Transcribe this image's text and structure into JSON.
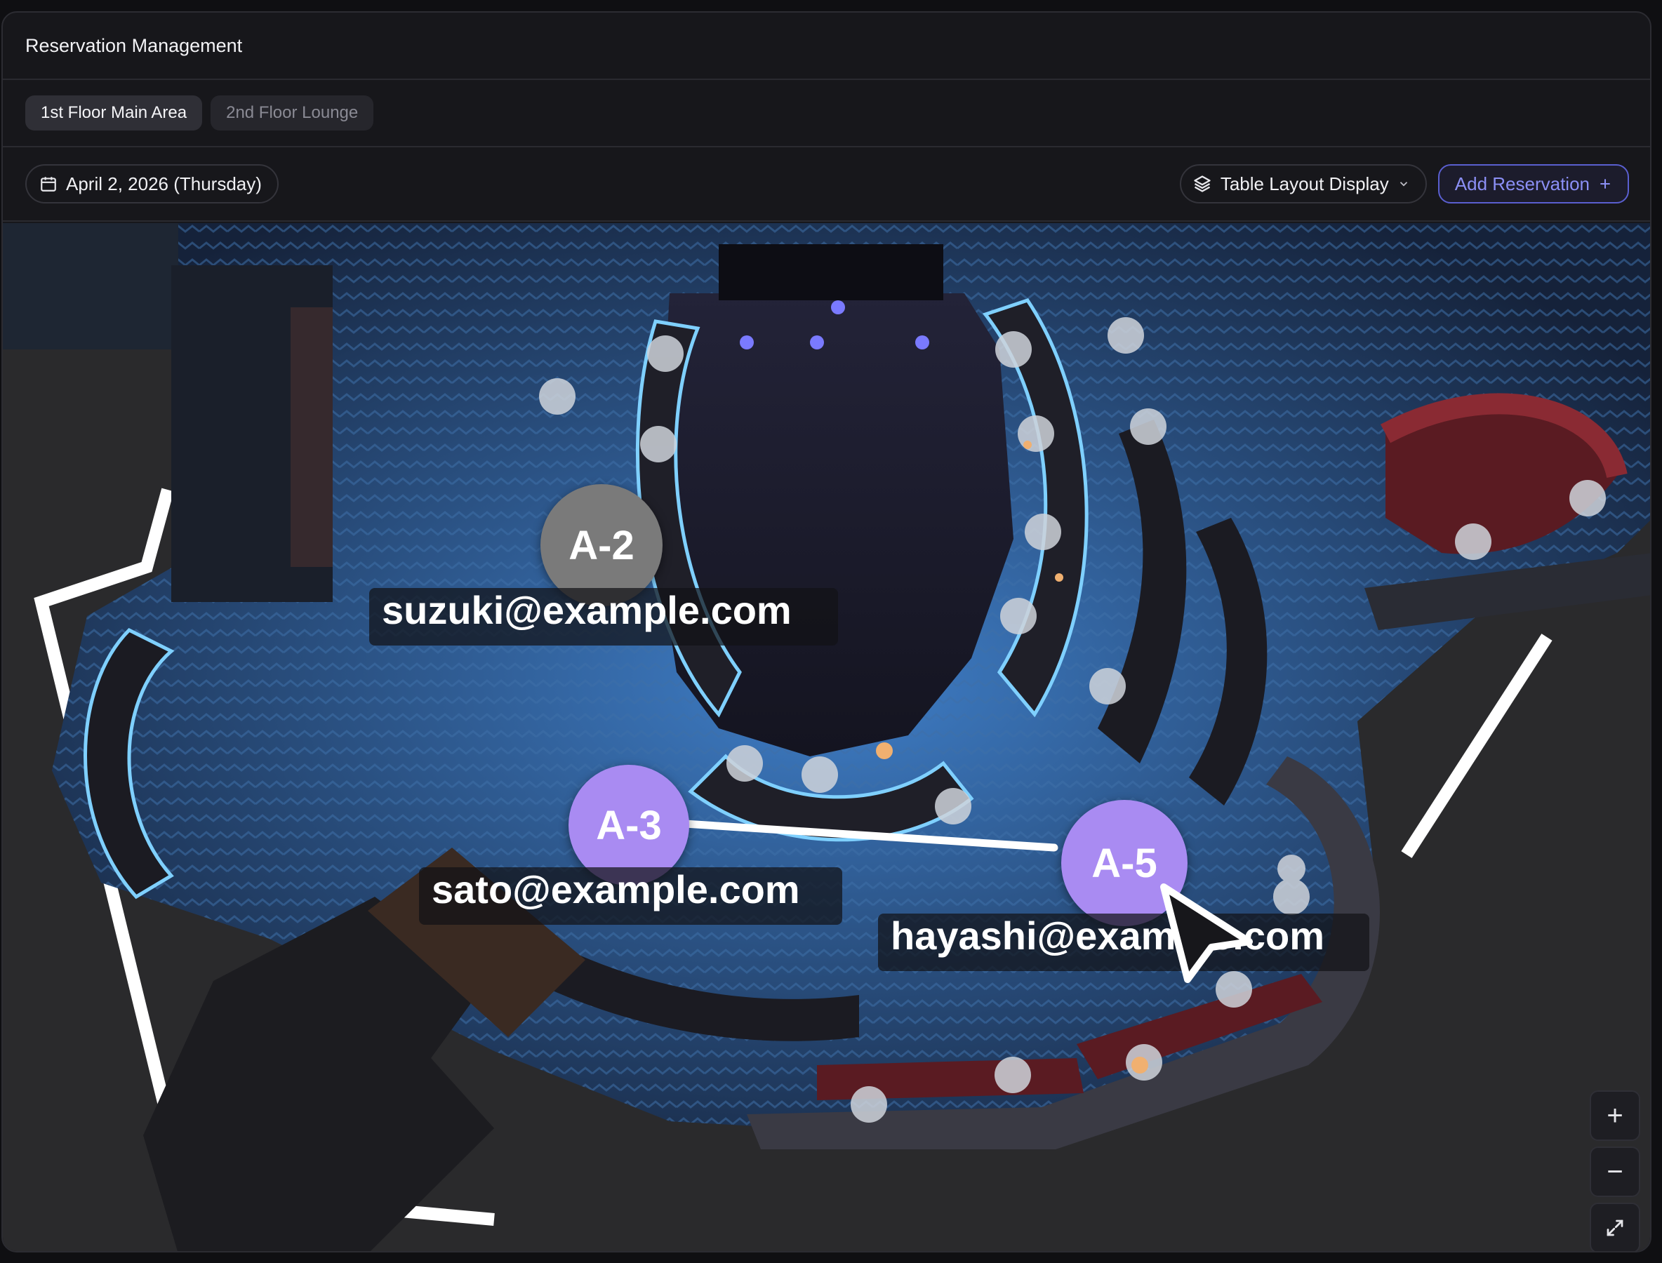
{
  "app": {
    "title": "Reservation Management"
  },
  "tabs": [
    {
      "label": "1st Floor Main Area",
      "active": true
    },
    {
      "label": "2nd Floor Lounge",
      "active": false
    }
  ],
  "toolbar": {
    "date_label": "April 2, 2026 (Thursday)",
    "date_icon": "calendar-icon",
    "layout_select_label": "Table Layout Display",
    "layout_icon": "layers-icon",
    "add_reservation_label": "Add Reservation",
    "add_icon": "plus-icon"
  },
  "floor_map": {
    "tables": [
      {
        "id": "A-2",
        "email": "suzuki@example.com",
        "color": "#7a7a7a"
      },
      {
        "id": "A-3",
        "email": "sato@example.com",
        "color": "#a98bf2"
      },
      {
        "id": "A-5",
        "email": "hayashi@example.com",
        "color": "#a98bf2"
      }
    ],
    "link": {
      "from": "A-3",
      "to": "A-5"
    },
    "zoom_controls": {
      "zoom_in": "+",
      "zoom_out": "−",
      "fit_icon": "expand-icon"
    }
  },
  "colors": {
    "accent": "#5a5fd0",
    "reserved_marker": "#a98bf2",
    "inactive_marker": "#7a7a7a",
    "neon": "#6fc6ff"
  }
}
